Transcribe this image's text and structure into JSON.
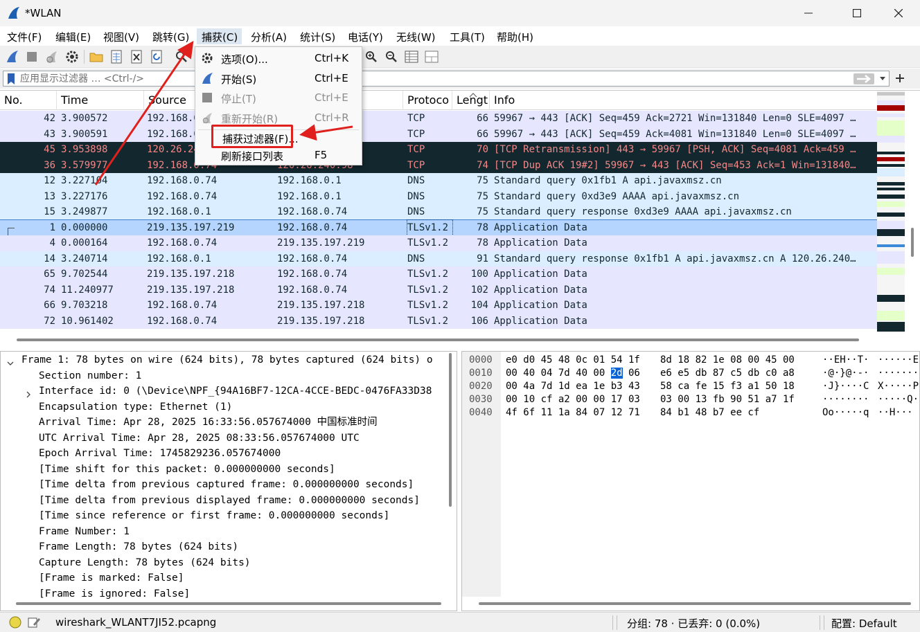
{
  "window": {
    "title": "*WLAN"
  },
  "menubar": {
    "items": [
      {
        "label": "文件(F)"
      },
      {
        "label": "编辑(E)"
      },
      {
        "label": "视图(V)"
      },
      {
        "label": "跳转(G)"
      },
      {
        "label": "捕获(C)"
      },
      {
        "label": "分析(A)"
      },
      {
        "label": "统计(S)"
      },
      {
        "label": "电话(Y)"
      },
      {
        "label": "无线(W)"
      },
      {
        "label": "工具(T)"
      },
      {
        "label": "帮助(H)"
      }
    ],
    "active_index": 4
  },
  "filter": {
    "placeholder": "应用显示过滤器 … <Ctrl-/>"
  },
  "capture_menu": {
    "items": [
      {
        "label": "选项(O)...",
        "shortcut": "Ctrl+K",
        "icon": "gear-icon",
        "enabled": true
      },
      {
        "label": "开始(S)",
        "shortcut": "Ctrl+E",
        "icon": "shark-fin-icon",
        "enabled": true
      },
      {
        "label": "停止(T)",
        "shortcut": "Ctrl+E",
        "icon": "stop-square-icon",
        "enabled": false
      },
      {
        "label": "重新开始(R)",
        "shortcut": "Ctrl+R",
        "icon": "restart-fin-icon",
        "enabled": false
      },
      {
        "label": "捕获过滤器(F)...",
        "shortcut": "",
        "icon": "",
        "enabled": true
      },
      {
        "label": "刷新接口列表",
        "shortcut": "F5",
        "icon": "",
        "enabled": true
      }
    ],
    "highlighted_index": 4
  },
  "packet_list": {
    "columns": [
      "No.",
      "Time",
      "Source",
      "Destination",
      "Protoco",
      "Lengt",
      "Info"
    ],
    "rows": [
      {
        "no": "42",
        "time": "3.900572",
        "src": "192.168.0.74",
        "dst": "",
        "proto": "TCP",
        "len": "66",
        "info": "59967 → 443 [ACK] Seq=459 Ack=2721 Win=131840 Len=0 SLE=4097 …",
        "style": "tcp"
      },
      {
        "no": "43",
        "time": "3.900591",
        "src": "192.168.0.74",
        "dst": "",
        "proto": "TCP",
        "len": "66",
        "info": "59967 → 443 [ACK] Seq=459 Ack=4081 Win=131840 Len=0 SLE=4097 …",
        "style": "tcp"
      },
      {
        "no": "45",
        "time": "3.953898",
        "src": "120.26.240.98",
        "dst": "",
        "proto": "TCP",
        "len": "70",
        "info": "[TCP Retransmission] 443 → 59967 [PSH, ACK] Seq=4081 Ack=459 …",
        "style": "bad"
      },
      {
        "no": "36",
        "time": "3.579977",
        "src": "192.168.0.74",
        "dst": "120.26.240.98",
        "proto": "TCP",
        "len": "74",
        "info": "[TCP Dup ACK 19#2] 59967 → 443 [ACK] Seq=453 Ack=1 Win=131840…",
        "style": "bad"
      },
      {
        "no": "12",
        "time": "3.227104",
        "src": "192.168.0.74",
        "dst": "192.168.0.1",
        "proto": "DNS",
        "len": "75",
        "info": "Standard query 0x1fb1 A api.javaxmsz.cn",
        "style": "udp"
      },
      {
        "no": "13",
        "time": "3.227176",
        "src": "192.168.0.74",
        "dst": "192.168.0.1",
        "proto": "DNS",
        "len": "75",
        "info": "Standard query 0xd3e9 AAAA api.javaxmsz.cn",
        "style": "udp"
      },
      {
        "no": "15",
        "time": "3.249877",
        "src": "192.168.0.1",
        "dst": "192.168.0.74",
        "proto": "DNS",
        "len": "75",
        "info": "Standard query response 0xd3e9 AAAA api.javaxmsz.cn",
        "style": "udp"
      },
      {
        "no": "1",
        "time": "0.000000",
        "src": "219.135.197.219",
        "dst": "192.168.0.74",
        "proto": "TLSv1.2",
        "len": "78",
        "info": "Application Data",
        "style": "selected"
      },
      {
        "no": "4",
        "time": "0.000164",
        "src": "192.168.0.74",
        "dst": "219.135.197.219",
        "proto": "TLSv1.2",
        "len": "78",
        "info": "Application Data",
        "style": "tcp"
      },
      {
        "no": "14",
        "time": "3.240714",
        "src": "192.168.0.1",
        "dst": "192.168.0.74",
        "proto": "DNS",
        "len": "91",
        "info": "Standard query response 0x1fb1 A api.javaxmsz.cn A 120.26.240…",
        "style": "udp"
      },
      {
        "no": "65",
        "time": "9.702544",
        "src": "219.135.197.218",
        "dst": "192.168.0.74",
        "proto": "TLSv1.2",
        "len": "100",
        "info": "Application Data",
        "style": "tcp"
      },
      {
        "no": "74",
        "time": "11.240977",
        "src": "219.135.197.218",
        "dst": "192.168.0.74",
        "proto": "TLSv1.2",
        "len": "102",
        "info": "Application Data",
        "style": "tcp"
      },
      {
        "no": "66",
        "time": "9.703218",
        "src": "192.168.0.74",
        "dst": "219.135.197.218",
        "proto": "TLSv1.2",
        "len": "104",
        "info": "Application Data",
        "style": "tcp"
      },
      {
        "no": "72",
        "time": "10.961402",
        "src": "192.168.0.74",
        "dst": "219.135.197.218",
        "proto": "TLSv1.2",
        "len": "106",
        "info": "Application Data",
        "style": "tcp"
      }
    ]
  },
  "details": {
    "lines": [
      {
        "text": "Frame 1: 78 bytes on wire (624 bits), 78 bytes captured (624 bits) o",
        "indent": 0,
        "expander": "open"
      },
      {
        "text": "Section number: 1",
        "indent": 1,
        "expander": ""
      },
      {
        "text": "Interface id: 0 (\\Device\\NPF_{94A16BF7-12CA-4CCE-BEDC-0476FA33D38",
        "indent": 1,
        "expander": "closed"
      },
      {
        "text": "Encapsulation type: Ethernet (1)",
        "indent": 1,
        "expander": ""
      },
      {
        "text": "Arrival Time: Apr 28, 2025 16:33:56.057674000 中国标准时间",
        "indent": 1,
        "expander": ""
      },
      {
        "text": "UTC Arrival Time: Apr 28, 2025 08:33:56.057674000 UTC",
        "indent": 1,
        "expander": ""
      },
      {
        "text": "Epoch Arrival Time: 1745829236.057674000",
        "indent": 1,
        "expander": ""
      },
      {
        "text": "[Time shift for this packet: 0.000000000 seconds]",
        "indent": 1,
        "expander": ""
      },
      {
        "text": "[Time delta from previous captured frame: 0.000000000 seconds]",
        "indent": 1,
        "expander": ""
      },
      {
        "text": "[Time delta from previous displayed frame: 0.000000000 seconds]",
        "indent": 1,
        "expander": ""
      },
      {
        "text": "[Time since reference or first frame: 0.000000000 seconds]",
        "indent": 1,
        "expander": ""
      },
      {
        "text": "Frame Number: 1",
        "indent": 1,
        "expander": ""
      },
      {
        "text": "Frame Length: 78 bytes (624 bits)",
        "indent": 1,
        "expander": ""
      },
      {
        "text": "Capture Length: 78 bytes (624 bits)",
        "indent": 1,
        "expander": ""
      },
      {
        "text": "[Frame is marked: False]",
        "indent": 1,
        "expander": ""
      },
      {
        "text": "[Frame is ignored: False]",
        "indent": 1,
        "expander": ""
      }
    ]
  },
  "bytes": {
    "rows": [
      {
        "offset": "0000",
        "hex1": "e0 d0 45 48 0c 01 54 1f",
        "hex2": "8d 18 82 1e 08 00 45 00",
        "ascii1": "··EH··T·",
        "ascii2": "······E·"
      },
      {
        "offset": "0010",
        "hex1": "00 40 04 7d 40 00 2d 06",
        "hex2": "e6 e5 db 87 c5 db c0 a8",
        "ascii1": "·@·}@·-·",
        "ascii2": "········"
      },
      {
        "offset": "0020",
        "hex1": "00 4a 7d 1d ea 1e b3 43",
        "hex2": "58 ca fe 15 f3 a1 50 18",
        "ascii1": "·J}····C",
        "ascii2": "X·····P·"
      },
      {
        "offset": "0030",
        "hex1": "00 10 cf a2 00 00 17 03",
        "hex2": "03 00 13 fb 90 51 a7 1f",
        "ascii1": "········",
        "ascii2": "·····Q··"
      },
      {
        "offset": "0040",
        "hex1": "4f 6f 11 1a 84 07 12 71",
        "hex2": "84 b1 48 b7 ee cf",
        "ascii1": "Oo·····q",
        "ascii2": "··H···"
      }
    ],
    "highlight_byte": "2d"
  },
  "status": {
    "filename": "wireshark_WLANT7JI52.pcapng",
    "packets": "分组: 78 · 已丢弃: 0 (0.0%)",
    "profile": "配置: Default"
  },
  "colors": {
    "tcp_row": "#e7e6ff",
    "udp_row": "#daeeff",
    "bad_row": "#12272e",
    "bad_text": "#f78787",
    "selected_row": "#b5d5ff",
    "annotation": "#e0201c"
  }
}
